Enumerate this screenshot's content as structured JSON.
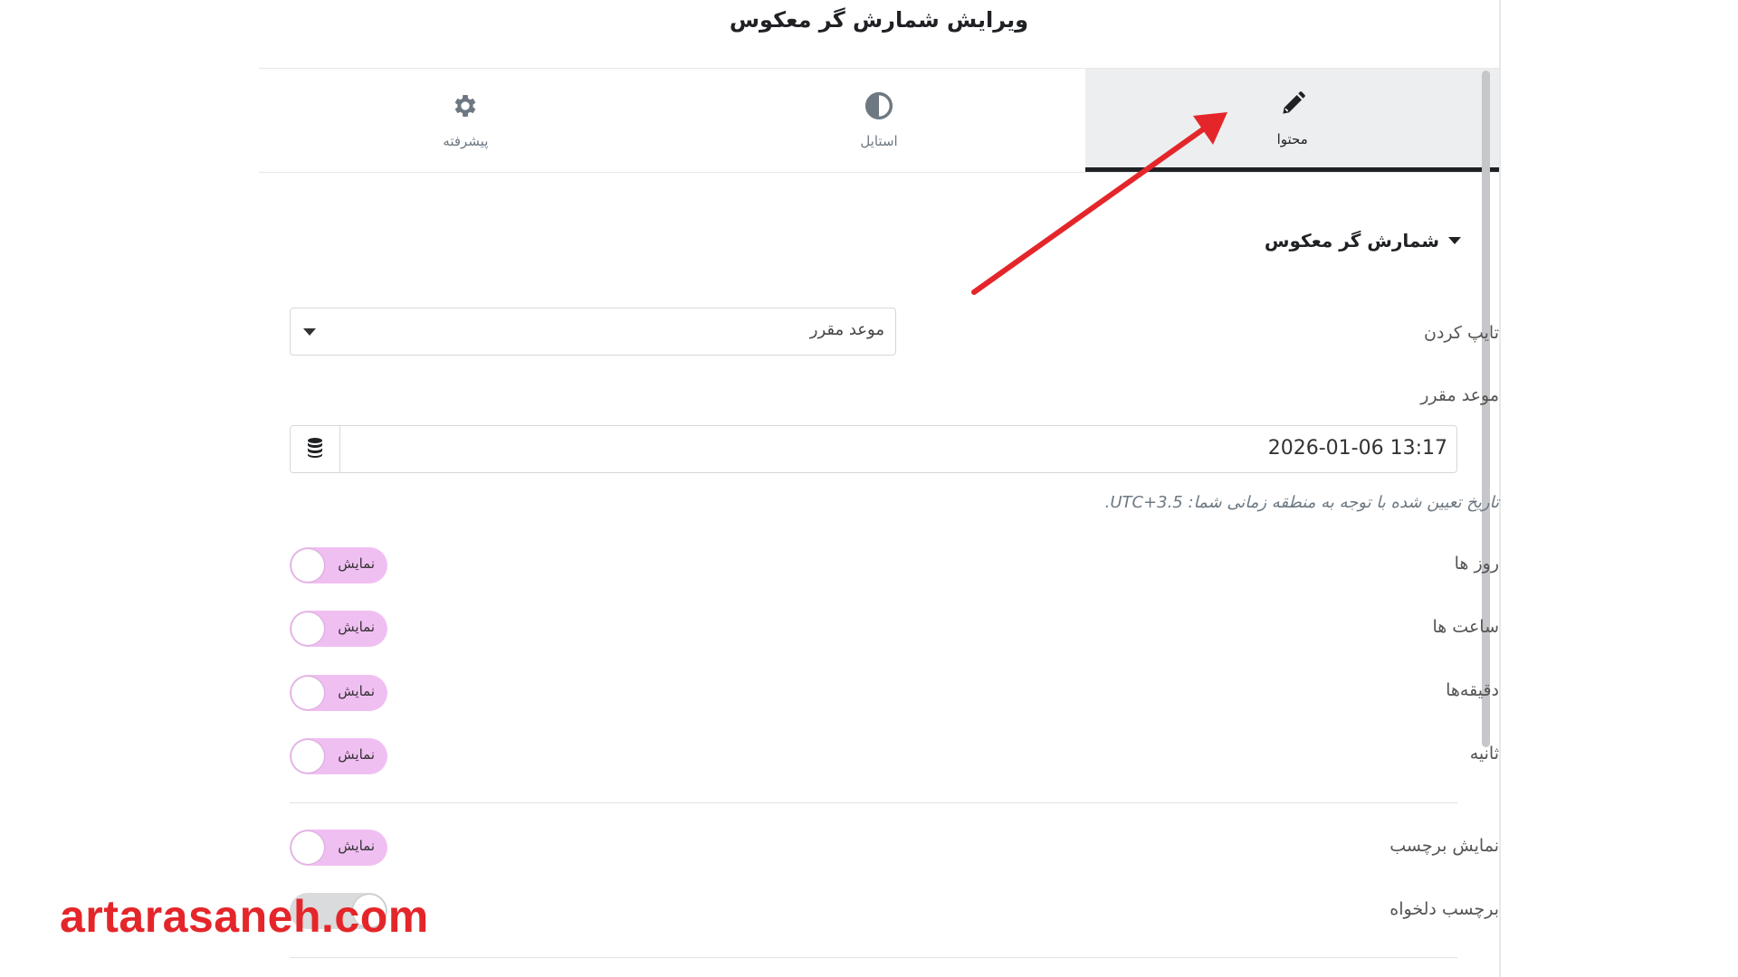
{
  "panel": {
    "title": "ویرایش شمارش گر معکوس"
  },
  "tabs": [
    {
      "label": "محتوا",
      "icon": "pencil-icon",
      "active": true
    },
    {
      "label": "استایل",
      "icon": "contrast-icon",
      "active": false
    },
    {
      "label": "پیشرفته",
      "icon": "gear-icon",
      "active": false
    }
  ],
  "section": {
    "title": "شمارش گر معکوس"
  },
  "fields": {
    "type_label": "تایپ کردن",
    "type_value": "موعد مقرر",
    "due_label": "موعد مقرر",
    "due_value": "2026-01-06 13:17",
    "due_hint": "تاریخ تعیین شده با توجه به منطقه زمانی شما: UTC+3.5."
  },
  "toggles": [
    {
      "label": "روز ها",
      "state": "نمایش"
    },
    {
      "label": "ساعت ها",
      "state": "نمایش"
    },
    {
      "label": "دقیقه‌ها",
      "state": "نمایش"
    },
    {
      "label": "ثانیه",
      "state": "نمایش"
    },
    {
      "label": "نمایش برچسب",
      "state": "نمایش"
    },
    {
      "label": "برچسب دلخواه",
      "state": ""
    }
  ],
  "watermark": "artarasaneh.com",
  "colors": {
    "toggle_on": "#f0bff2",
    "annotation_arrow": "#e4262a",
    "active_tab_underline": "#1f2124"
  }
}
